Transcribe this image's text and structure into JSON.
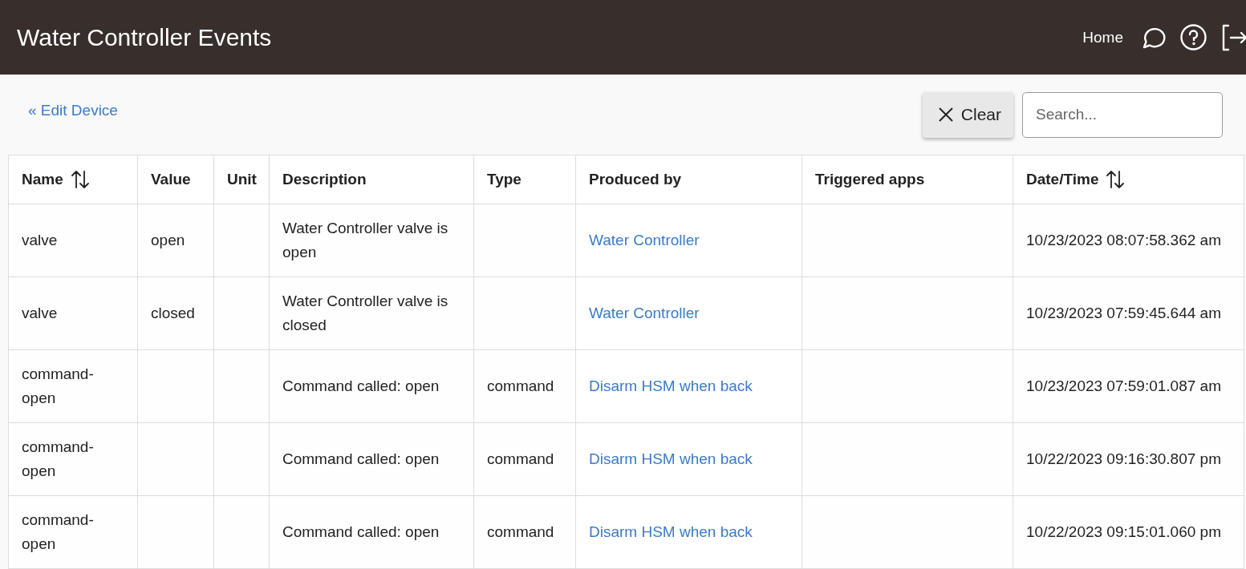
{
  "header": {
    "title": "Water Controller Events",
    "nav_link": "Home"
  },
  "toolbar": {
    "back_link": "« Edit Device",
    "clear_button": "Clear",
    "search": {
      "placeholder": "Search..."
    }
  },
  "table": {
    "columns": [
      {
        "label": "Name",
        "sortable": true,
        "kind": "text"
      },
      {
        "label": "Value",
        "sortable": false,
        "kind": "text"
      },
      {
        "label": "Unit",
        "sortable": false,
        "kind": "text"
      },
      {
        "label": "Description",
        "sortable": false,
        "kind": "text"
      },
      {
        "label": "Type",
        "sortable": false,
        "kind": "text"
      },
      {
        "label": "Produced by",
        "sortable": false,
        "kind": "link"
      },
      {
        "label": "Triggered apps",
        "sortable": false,
        "kind": "text"
      },
      {
        "label": "Date/Time",
        "sortable": true,
        "kind": "text"
      }
    ],
    "rows": [
      [
        "valve",
        "open",
        null,
        "Water Controller valve is open",
        null,
        "Water Controller",
        null,
        "10/23/2023 08:07:58.362 am"
      ],
      [
        "valve",
        "closed",
        null,
        "Water Controller valve is closed",
        null,
        "Water Controller",
        null,
        "10/23/2023 07:59:45.644 am"
      ],
      [
        "command-open",
        null,
        null,
        "Command called: open",
        "command",
        "Disarm HSM when back",
        null,
        "10/23/2023 07:59:01.087 am"
      ],
      [
        "command-open",
        null,
        null,
        "Command called: open",
        "command",
        "Disarm HSM when back",
        null,
        "10/22/2023 09:16:30.807 pm"
      ],
      [
        "command-open",
        null,
        null,
        "Command called: open",
        "command",
        "Disarm HSM when back",
        null,
        "10/22/2023 09:15:01.060 pm"
      ]
    ]
  }
}
